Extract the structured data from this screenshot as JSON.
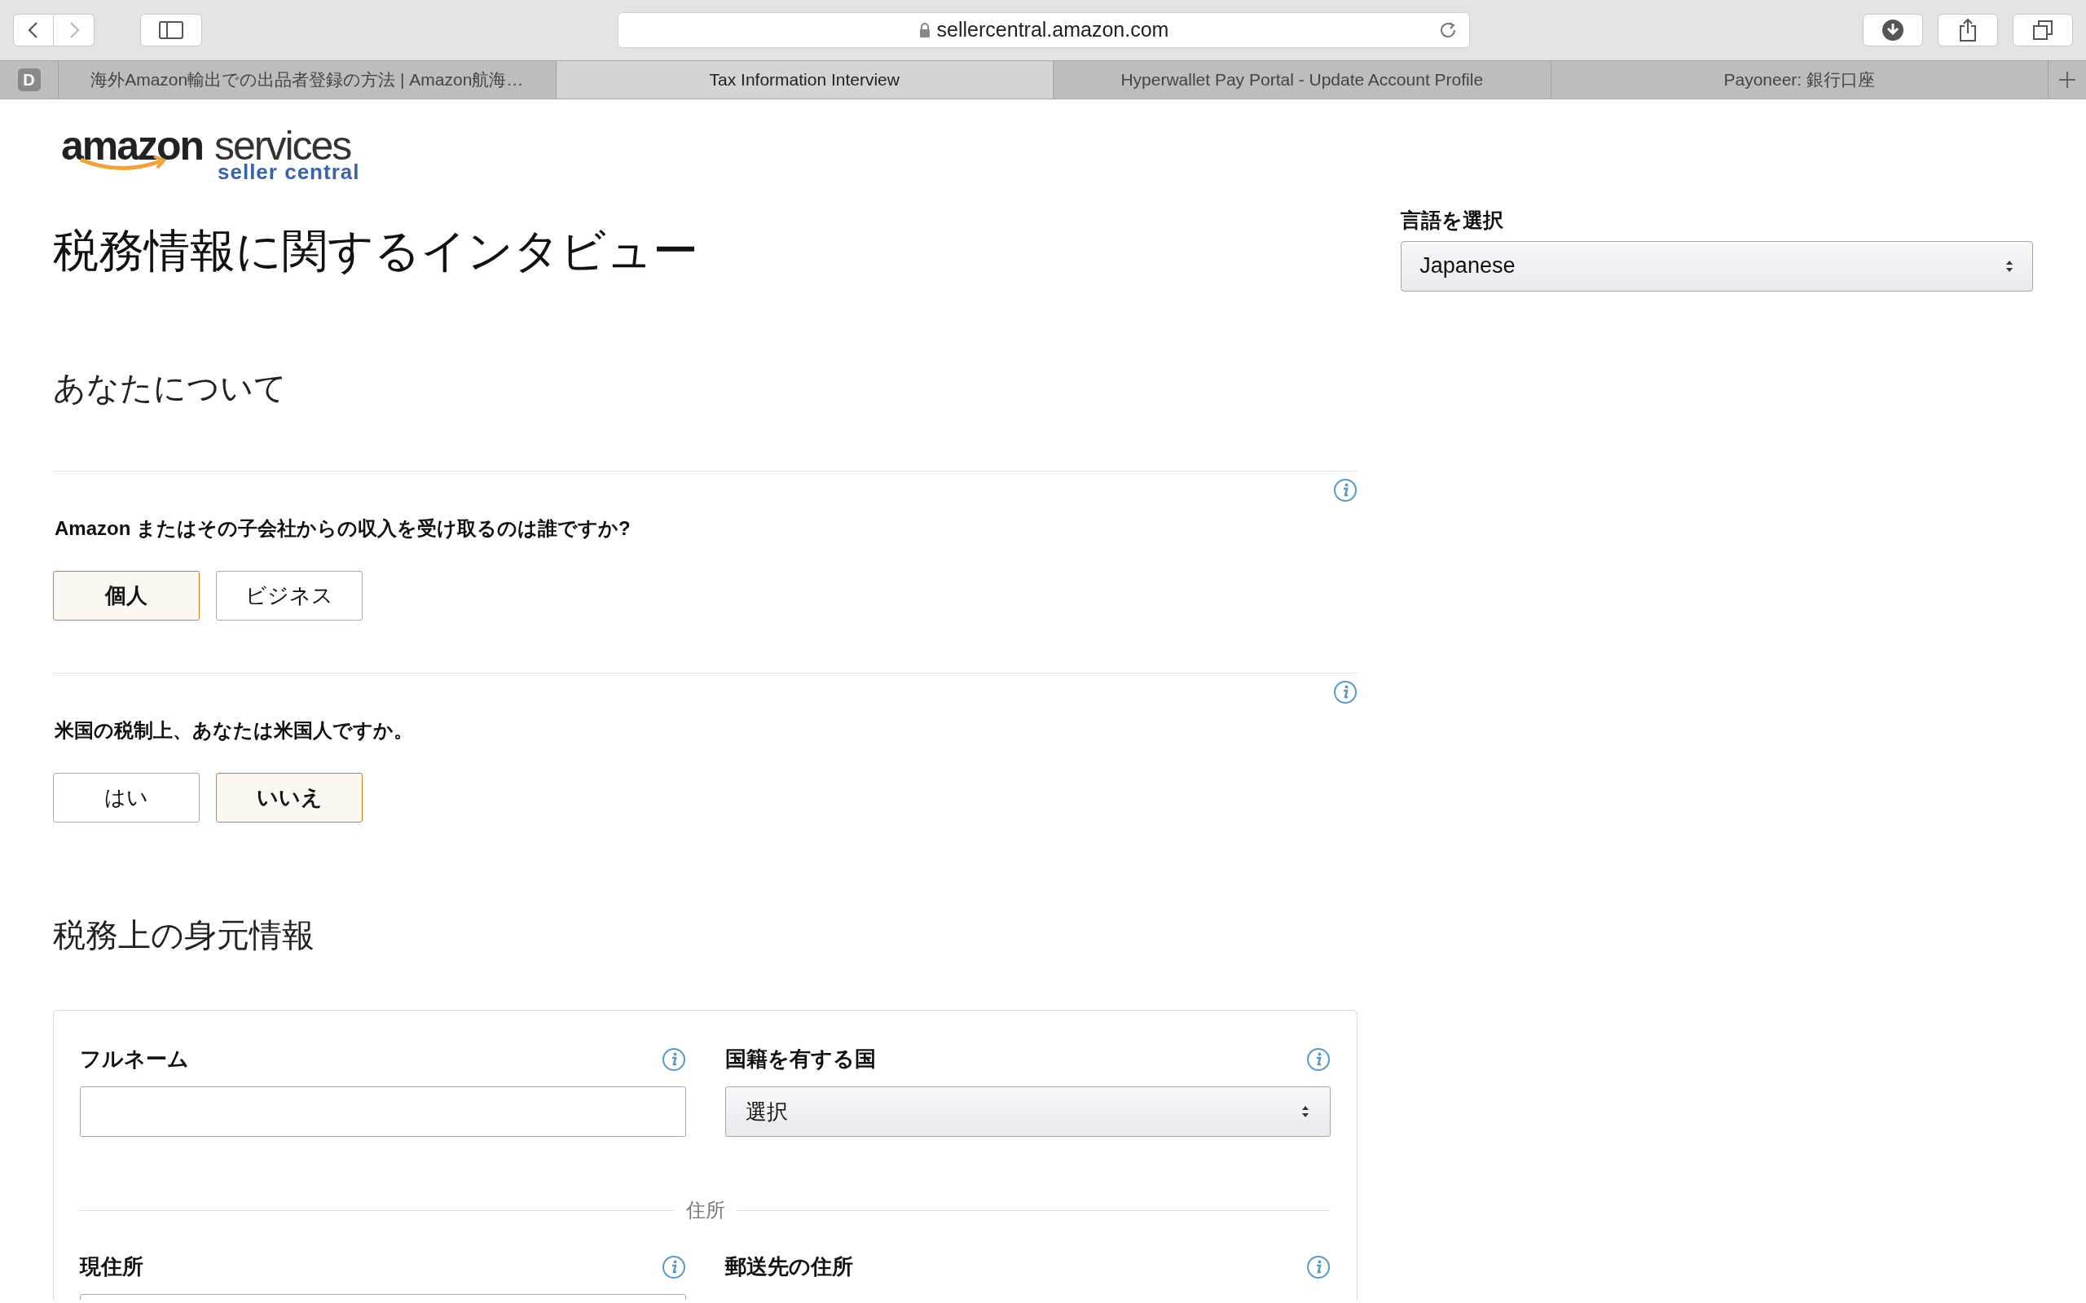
{
  "browser": {
    "address": "sellercentral.amazon.com",
    "favicon_letter": "D",
    "tabs": [
      {
        "title": "海外Amazon輸出での出品者登録の方法 | Amazon航海…",
        "selected": false
      },
      {
        "title": "Tax Information Interview",
        "selected": true
      },
      {
        "title": "Hyperwallet Pay Portal - Update Account Profile",
        "selected": false
      },
      {
        "title": "Payoneer: 銀行口座",
        "selected": false
      }
    ]
  },
  "logo": {
    "brand": "amazon",
    "services": "services",
    "tagline": "seller central"
  },
  "title": "税務情報に関するインタビュー",
  "language": {
    "label": "言語を選択",
    "value": "Japanese"
  },
  "about": {
    "heading": "あなたについて",
    "questions": [
      {
        "text": "Amazon またはその子会社からの収入を受け取るのは誰ですか?",
        "options": [
          {
            "label": "個人",
            "selected": true
          },
          {
            "label": "ビジネス",
            "selected": false
          }
        ]
      },
      {
        "text": "米国の税制上、あなたは米国人ですか。",
        "options": [
          {
            "label": "はい",
            "selected": false
          },
          {
            "label": "いいえ",
            "selected": true
          }
        ]
      }
    ]
  },
  "identity": {
    "heading": "税務上の身元情報",
    "rows": [
      [
        {
          "label": "フルネーム",
          "kind": "text"
        },
        {
          "label": "国籍を有する国",
          "kind": "select",
          "value": "選択"
        }
      ]
    ],
    "divider": "住所",
    "address_rows": [
      [
        {
          "label": "現住所",
          "kind": "text"
        },
        {
          "label": "郵送先の住所",
          "kind": "none"
        }
      ]
    ]
  }
}
